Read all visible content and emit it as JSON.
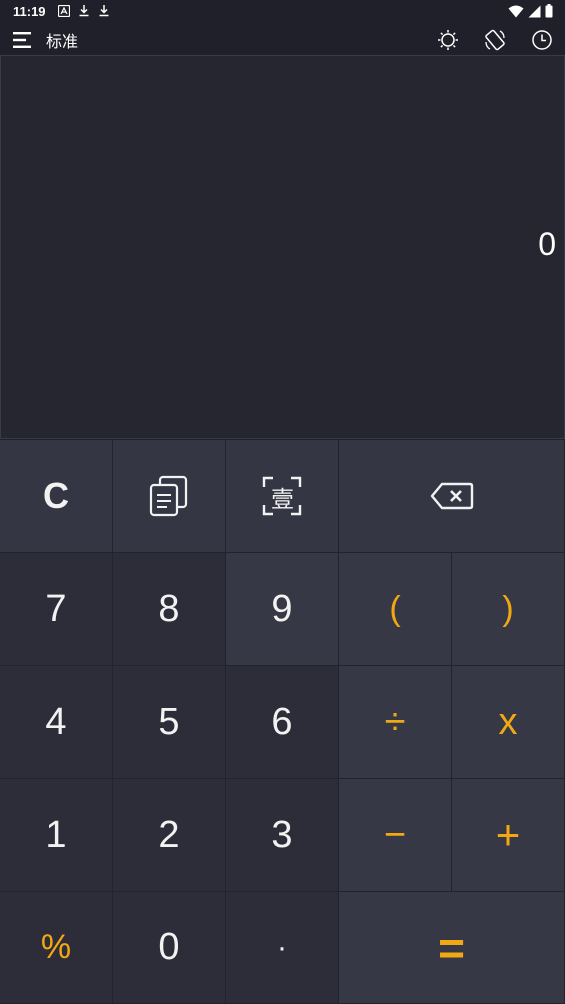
{
  "status_bar": {
    "time": "11:19",
    "left_icons": [
      "translate-icon",
      "download-icon",
      "download-icon"
    ],
    "right_icons": [
      "wifi-icon",
      "signal-icon",
      "battery-icon"
    ]
  },
  "toolbar": {
    "title": "标准",
    "icons": [
      "menu-icon",
      "theme-icon",
      "rotate-icon",
      "history-icon"
    ]
  },
  "display": {
    "value": "0"
  },
  "keypad": {
    "row1": {
      "clear": "C",
      "copy_icon": "copy-icon",
      "scan_icon": "scan-text-icon",
      "scan_text": "壹",
      "backspace_icon": "backspace-icon"
    },
    "row2": {
      "seven": "7",
      "eight": "8",
      "nine": "9",
      "lparen": "(",
      "rparen": ")"
    },
    "row3": {
      "four": "4",
      "five": "5",
      "six": "6",
      "divide": "÷",
      "multiply": "x"
    },
    "row4": {
      "one": "1",
      "two": "2",
      "three": "3",
      "minus": "−",
      "plus": "+"
    },
    "row5": {
      "percent": "%",
      "zero": "0",
      "dot": "·",
      "equals": "="
    }
  },
  "colors": {
    "background": "#1f2029",
    "display": "#262630",
    "accent": "#f2a813",
    "text": "#f2f2f2"
  }
}
